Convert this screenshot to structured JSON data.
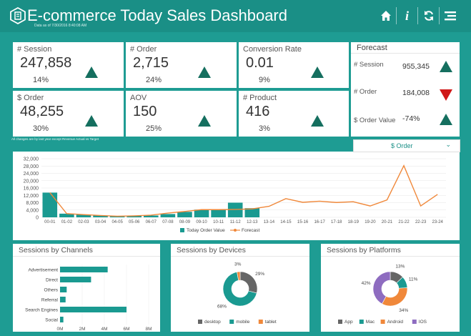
{
  "header": {
    "title": "E-commerce Today Sales Dashboard",
    "subtitle": "Data as of 7/30/2016 8:40:08 AM",
    "icons": [
      "home-icon",
      "info-icon",
      "refresh-icon",
      "menu-icon"
    ]
  },
  "kpis": [
    {
      "label": "# Session",
      "value": "247,858",
      "pct": "14%",
      "trend": "up"
    },
    {
      "label": "# Order",
      "value": "2,715",
      "pct": "24%",
      "trend": "up"
    },
    {
      "label": "Conversion Rate",
      "value": "0.01",
      "pct": "9%",
      "trend": "up"
    },
    {
      "label": "$ Order",
      "value": "48,255",
      "pct": "30%",
      "trend": "up"
    },
    {
      "label": "AOV",
      "value": "150",
      "pct": "25%",
      "trend": "up"
    },
    {
      "label": "# Product",
      "value": "416",
      "pct": "3%",
      "trend": "up"
    }
  ],
  "forecast": {
    "title": "Forecast",
    "rows": [
      {
        "label": "# Session",
        "value": "955,345",
        "trend": "up"
      },
      {
        "label": "# Order",
        "value": "184,008",
        "trend": "down"
      },
      {
        "label": "$ Order Value",
        "value": "-74%",
        "trend": "up"
      }
    ]
  },
  "note": "All changes are by last year except Revenue Actual vs Target",
  "metric_select": {
    "selected": "$ Order"
  },
  "colors": {
    "teal": "#1a9a91",
    "orange": "#f0883a",
    "up": "#156f5f",
    "down": "#d01818",
    "purple": "#8e6cc0",
    "grey": "#666666"
  },
  "chart_data": [
    {
      "type": "bar",
      "categories": [
        "00-01",
        "01-02",
        "02-03",
        "03-04",
        "04-05",
        "05-06",
        "06-07",
        "07-08",
        "08-09",
        "09-10",
        "10-11",
        "11-12",
        "12-13",
        "13-14",
        "14-15",
        "15-16",
        "16-17",
        "17-18",
        "18-19",
        "19-20",
        "20-21",
        "21-22",
        "22-23",
        "23-24"
      ],
      "series": [
        {
          "name": "Today Order Value",
          "type": "bar",
          "values": [
            13500,
            2000,
            1500,
            1000,
            800,
            800,
            1000,
            1800,
            3000,
            4200,
            4200,
            8000,
            5000,
            null,
            null,
            null,
            null,
            null,
            null,
            null,
            null,
            null,
            null,
            null
          ]
        },
        {
          "name": "Forecast",
          "type": "line",
          "values": [
            13500,
            2000,
            1500,
            1000,
            600,
            800,
            1200,
            2300,
            3200,
            4200,
            4200,
            4300,
            4600,
            6000,
            10200,
            8200,
            8800,
            8100,
            8500,
            6200,
            9500,
            28200,
            6200,
            12500
          ]
        }
      ],
      "ylim": [
        0,
        32000
      ],
      "yticks": [
        "0",
        "4,000",
        "8,000",
        "12,000",
        "16,000",
        "20,000",
        "24,000",
        "28,000",
        "32,000"
      ],
      "grid": true,
      "legend": "bottom"
    },
    {
      "type": "bar",
      "title": "Sessions by Channels",
      "categories": [
        "Advertisement",
        "Direct",
        "Others",
        "Referral",
        "Search Engines",
        "Social"
      ],
      "values": [
        4300000,
        2800000,
        600000,
        500000,
        6000000,
        300000
      ],
      "xticks": [
        "0M",
        "2M",
        "4M",
        "6M",
        "8M"
      ],
      "xlim": [
        0,
        8000000
      ],
      "orientation": "horizontal"
    },
    {
      "type": "pie",
      "title": "Sessions by Devices",
      "categories": [
        "desktop",
        "mobile",
        "tablet"
      ],
      "values": [
        29,
        68,
        3
      ],
      "labels": [
        "29%",
        "68%",
        "3%"
      ],
      "legend": "bottom"
    },
    {
      "type": "pie",
      "title": "Sessions by Platforms",
      "categories": [
        "App",
        "Mac",
        "Android",
        "IOS"
      ],
      "values": [
        13,
        11,
        34,
        42
      ],
      "labels": [
        "13%",
        "11%",
        "34%",
        "42%"
      ],
      "legend": "bottom"
    }
  ]
}
